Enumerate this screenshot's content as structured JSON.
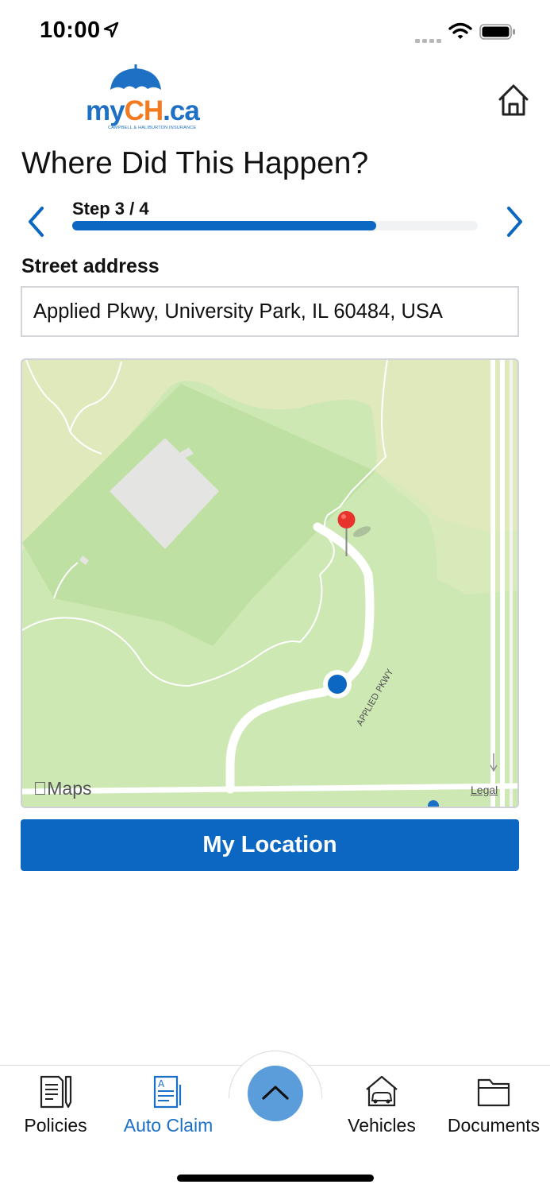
{
  "status_bar": {
    "time": "10:00",
    "icons": [
      "location-arrow-icon",
      "cellular-signal-icon",
      "wifi-icon",
      "battery-icon"
    ]
  },
  "header": {
    "logo": {
      "my": "my",
      "ch": "CH",
      "ca": ".ca",
      "tagline": "CAMPBELL & HALIBURTON INSURANCE"
    },
    "home_icon": "house-icon"
  },
  "page": {
    "title": "Where Did This Happen?"
  },
  "stepper": {
    "label": "Step 3 / 4",
    "progress": 0.75,
    "prev_icon": "chevron-left-icon",
    "next_icon": "chevron-right-icon"
  },
  "address": {
    "label": "Street address",
    "value": "Applied Pkwy, University Park, IL 60484, USA"
  },
  "map": {
    "brand": "Maps",
    "legal": "Legal",
    "road_label": "APPLIED PKWY",
    "pin_icon": "map-pin-icon",
    "user_location_icon": "current-location-dot-icon"
  },
  "actions": {
    "my_location": "My Location"
  },
  "tabbar": {
    "tabs": [
      {
        "label": "Policies",
        "icon": "policy-document-icon",
        "active": false
      },
      {
        "label": "Auto Claim",
        "icon": "claim-form-icon",
        "active": true
      },
      {
        "label": "Vehicles",
        "icon": "garage-car-icon",
        "active": false
      },
      {
        "label": "Documents",
        "icon": "folder-icon",
        "active": false
      }
    ],
    "center_icon": "chevron-up-icon"
  },
  "colors": {
    "primary": "#0b67c2",
    "logo_orange": "#f47a20",
    "active_tab": "#1a6fc6",
    "fab": "#5b9ddb",
    "pin": "#e8322c"
  }
}
